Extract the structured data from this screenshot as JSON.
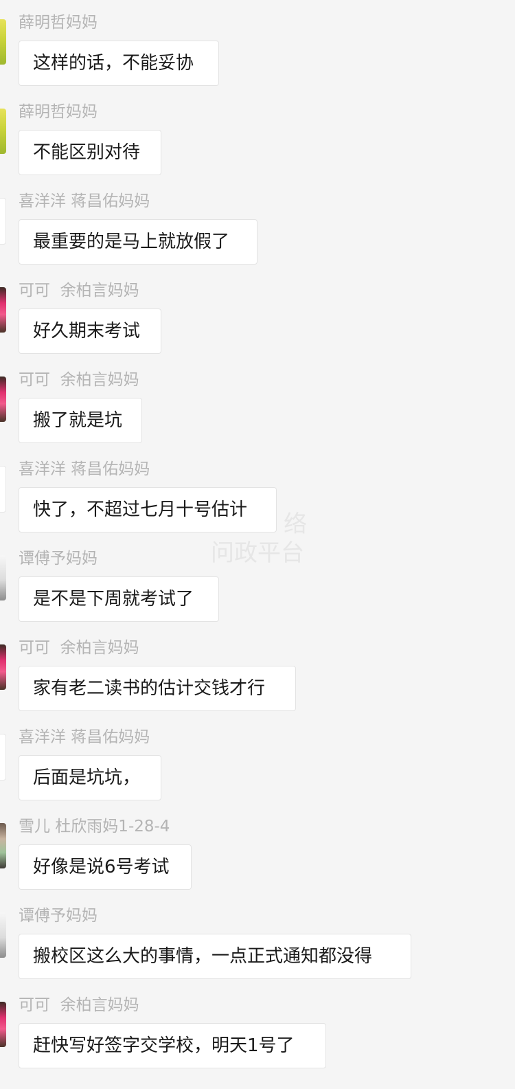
{
  "messages": [
    {
      "sender": "薛明哲妈妈",
      "text": "这样的话，不能妥协",
      "avatar": "yellow"
    },
    {
      "sender": "薛明哲妈妈",
      "text": "不能区别对待",
      "avatar": "yellow"
    },
    {
      "sender": "喜洋洋 蒋昌佑妈妈",
      "text": "最重要的是马上就放假了",
      "avatar": "white"
    },
    {
      "sender": "可可  余柏言妈妈",
      "text": "好久期末考试",
      "avatar": "pink"
    },
    {
      "sender": "可可  余柏言妈妈",
      "text": "搬了就是坑",
      "avatar": "pink"
    },
    {
      "sender": "喜洋洋 蒋昌佑妈妈",
      "text": "快了，不超过七月十号估计",
      "avatar": "white"
    },
    {
      "sender": "谭傅予妈妈",
      "text": "是不是下周就考试了",
      "avatar": "grey"
    },
    {
      "sender": "可可  余柏言妈妈",
      "text": "家有老二读书的估计交钱才行",
      "avatar": "pink"
    },
    {
      "sender": "喜洋洋 蒋昌佑妈妈",
      "text": "后面是坑坑，",
      "avatar": "white"
    },
    {
      "sender": "雪儿 杜欣雨妈1-28-4",
      "text": "好像是说6号考试",
      "avatar": "mixed"
    },
    {
      "sender": "谭傅予妈妈",
      "text": "搬校区这么大的事情，一点正式通知都没得",
      "avatar": "grey"
    },
    {
      "sender": "可可  余柏言妈妈",
      "text": "赶快写好签字交学校，明天1号了",
      "avatar": "pink"
    }
  ],
  "watermark": {
    "line1": "络",
    "line2": "问政平台"
  }
}
